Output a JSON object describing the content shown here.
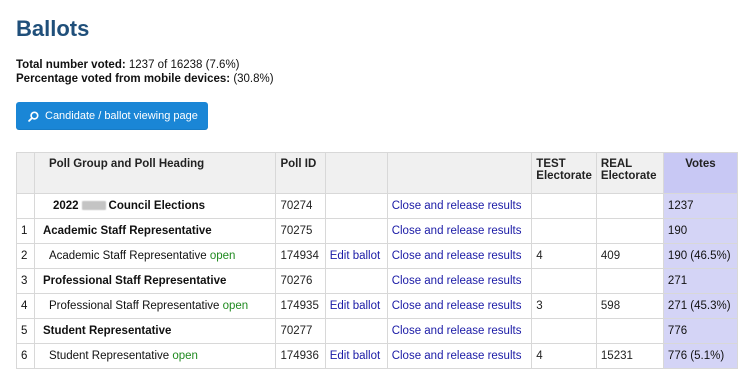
{
  "page": {
    "title": "Ballots",
    "stats": [
      {
        "label": "Total number voted:",
        "value": "1237 of 16238 (7.6%)"
      },
      {
        "label": "Percentage voted from mobile devices:",
        "value": "(30.8%)"
      }
    ],
    "button_label": "Candidate / ballot viewing page",
    "button_icon": "search-icon"
  },
  "table": {
    "headers": {
      "index": "",
      "poll": "Poll Group and Poll Heading",
      "poll_id": "Poll ID",
      "edit": "",
      "release": "",
      "test_line1": "TEST",
      "test_line2": "Electorate",
      "real_line1": "REAL",
      "real_line2": "Electorate",
      "votes": "Votes"
    },
    "group_row": {
      "label_pre": "2022",
      "label_post": "Council Elections",
      "poll_id": "70274",
      "release": "Close and release results",
      "votes": "1237"
    },
    "rows": [
      {
        "index": "1",
        "label": "Academic Staff Representative",
        "status": "",
        "poll_id": "70275",
        "edit": "",
        "release": "Close and release results",
        "test": "",
        "real": "",
        "votes": "190"
      },
      {
        "index": "2",
        "label": "Academic Staff Representative",
        "status": "open",
        "poll_id": "174934",
        "edit": "Edit ballot",
        "release": "Close and release results",
        "test": "4",
        "real": "409",
        "votes": "190 (46.5%)"
      },
      {
        "index": "3",
        "label": "Professional Staff Representative",
        "status": "",
        "poll_id": "70276",
        "edit": "",
        "release": "Close and release results",
        "test": "",
        "real": "",
        "votes": "271"
      },
      {
        "index": "4",
        "label": "Professional Staff Representative",
        "status": "open",
        "poll_id": "174935",
        "edit": "Edit ballot",
        "release": "Close and release results",
        "test": "3",
        "real": "598",
        "votes": "271 (45.3%)"
      },
      {
        "index": "5",
        "label": "Student Representative",
        "status": "",
        "poll_id": "70277",
        "edit": "",
        "release": "Close and release results",
        "test": "",
        "real": "",
        "votes": "776"
      },
      {
        "index": "6",
        "label": "Student Representative",
        "status": "open",
        "poll_id": "174936",
        "edit": "Edit ballot",
        "release": "Close and release results",
        "test": "4",
        "real": "15231",
        "votes": "776 (5.1%)"
      }
    ]
  },
  "colors": {
    "title": "#1f4f7a",
    "button_bg": "#1a86d6",
    "link": "#1a1aa6",
    "open_status": "#1f8a1f",
    "votes_column": "#d4d4f6"
  }
}
